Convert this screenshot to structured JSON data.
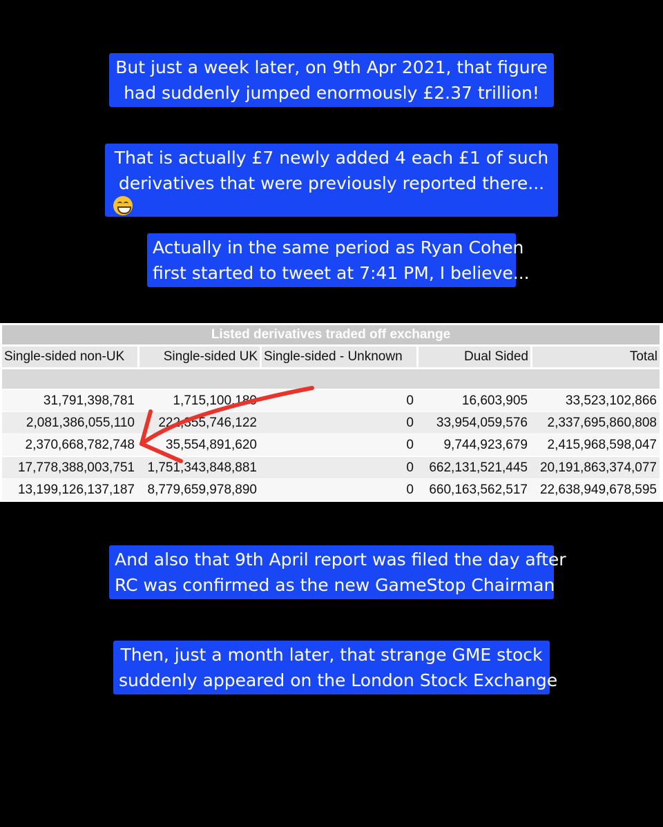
{
  "captions": [
    {
      "lines": [
        "But just a week later, on 9th Apr 2021, that figure",
        "had suddenly jumped enormously £2.37 trillion!"
      ]
    },
    {
      "lines": [
        "That is actually £7 newly added 4 each £1 of such",
        "derivatives that were previously reported there..."
      ],
      "emoji": "grinning-face-icon"
    },
    {
      "lines": [
        "Actually in the same period as Ryan Cohen",
        "first started to tweet at 7:41 PM, I believe..."
      ]
    },
    {
      "lines": [
        "And also that 9th April report was filed the day after",
        "RC was confirmed as the new GameStop Chairman"
      ]
    },
    {
      "lines": [
        "Then, just a month later, that strange GME stock",
        "suddenly appeared on the London Stock Exchange"
      ]
    }
  ],
  "table": {
    "title": "Listed derivatives traded off exchange",
    "headers": [
      "Single-sided non-UK",
      "Single-sided UK",
      "Single-sided - Unknown",
      "Dual Sided",
      "Total"
    ],
    "rows": [
      [
        "31,791,398,781",
        "1,715,100,180",
        "0",
        "16,603,905",
        "33,523,102,866"
      ],
      [
        "2,081,386,055,110",
        "222,355,746,122",
        "0",
        "33,954,059,576",
        "2,337,695,860,808"
      ],
      [
        "2,370,668,782,748",
        "35,554,891,620",
        "0",
        "9,744,923,679",
        "2,415,968,598,047"
      ],
      [
        "17,778,388,003,751",
        "1,751,343,848,881",
        "0",
        "662,131,521,445",
        "20,191,863,374,077"
      ],
      [
        "13,199,126,137,187",
        "8,779,659,978,890",
        "0",
        "660,163,562,517",
        "22,638,949,678,595"
      ]
    ]
  },
  "colors": {
    "caption_bg": "#1a47f5",
    "arrow": "#e8342a"
  }
}
